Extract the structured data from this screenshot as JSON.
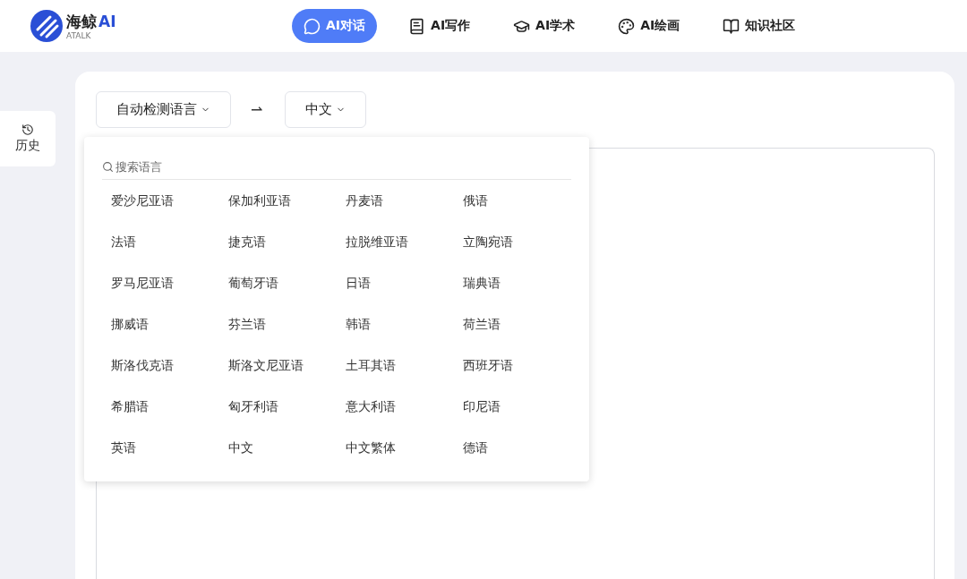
{
  "brand": {
    "name": "海鲸",
    "suffix": "AI",
    "sub": "ATALK"
  },
  "nav": [
    {
      "label": "AI对话",
      "selected": true
    },
    {
      "label": "AI写作",
      "selected": false
    },
    {
      "label": "AI学术",
      "selected": false
    },
    {
      "label": "AI绘画",
      "selected": false
    },
    {
      "label": "知识社区",
      "selected": false
    }
  ],
  "history": {
    "label": "历史"
  },
  "source_language": {
    "label": "自动检测语言"
  },
  "arrow": "⇀",
  "target_language": {
    "label": "中文"
  },
  "dropdown": {
    "placeholder": "搜索语言",
    "languages": [
      "爱沙尼亚语",
      "保加利亚语",
      "丹麦语",
      "俄语",
      "法语",
      "捷克语",
      "拉脱维亚语",
      "立陶宛语",
      "罗马尼亚语",
      "葡萄牙语",
      "日语",
      "瑞典语",
      "挪威语",
      "芬兰语",
      "韩语",
      "荷兰语",
      "斯洛伐克语",
      "斯洛文尼亚语",
      "土耳其语",
      "西班牙语",
      "希腊语",
      "匈牙利语",
      "意大利语",
      "印尼语",
      "英语",
      "中文",
      "中文繁体",
      "德语"
    ]
  }
}
